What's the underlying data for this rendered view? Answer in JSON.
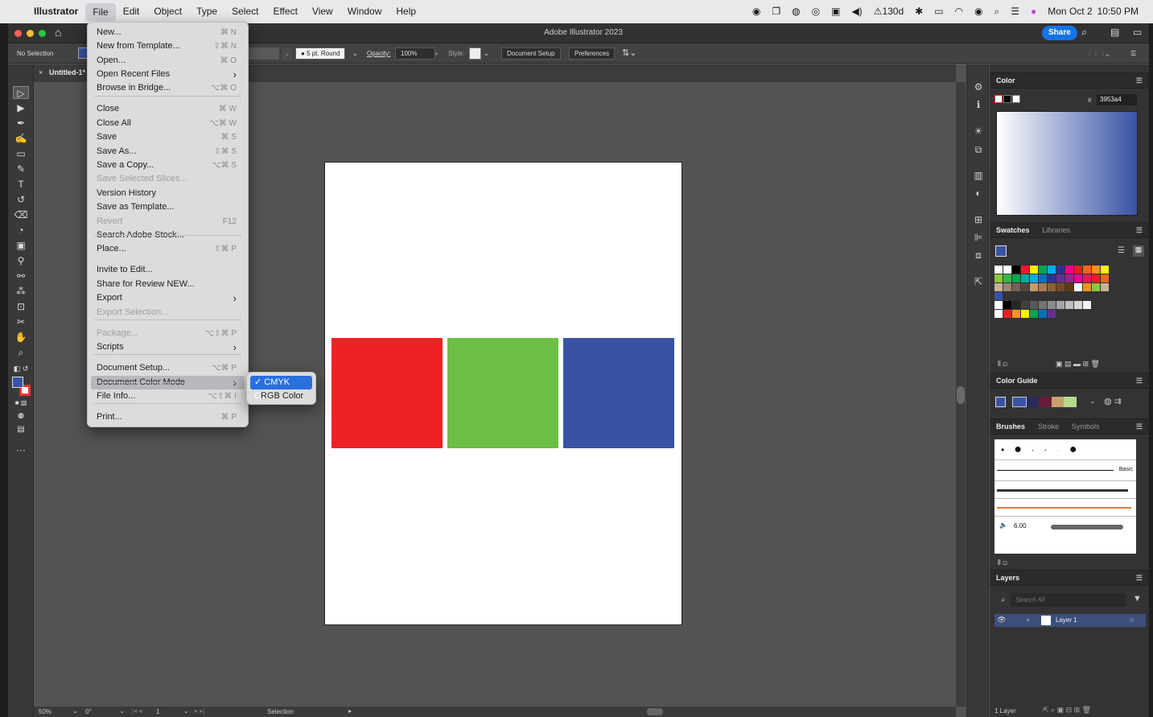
{
  "menubar": {
    "app": "Illustrator",
    "items": [
      "File",
      "Edit",
      "Object",
      "Type",
      "Select",
      "Effect",
      "View",
      "Window",
      "Help"
    ],
    "status": {
      "hdr": "130d",
      "date": "Mon Oct 2",
      "time": "10:50 PM"
    }
  },
  "window": {
    "title": "Adobe Illustrator 2023",
    "share_label": "Share"
  },
  "control": {
    "selection": "No Selection",
    "brush": "5 pt. Round",
    "opacity_label": "Opacity:",
    "opacity": "100%",
    "style_label": "Style:",
    "doc_setup": "Document Setup",
    "preferences": "Preferences"
  },
  "tab": {
    "label": "Untitled-1*"
  },
  "file_menu": [
    {
      "label": "New...",
      "shortcut": "⌘ N",
      "sep_before": false
    },
    {
      "label": "New from Template...",
      "shortcut": "⇧⌘ N"
    },
    {
      "label": "Open...",
      "shortcut": "⌘ O"
    },
    {
      "label": "Open Recent Files",
      "shortcut": "›"
    },
    {
      "label": "Browse in Bridge...",
      "shortcut": "⌥⌘ O"
    },
    {
      "label": "Close",
      "shortcut": "⌘ W",
      "sep_before": true
    },
    {
      "label": "Close All",
      "shortcut": "⌥⌘ W"
    },
    {
      "label": "Save",
      "shortcut": "⌘ S"
    },
    {
      "label": "Save As...",
      "shortcut": "⇧⌘ S"
    },
    {
      "label": "Save a Copy...",
      "shortcut": "⌥⌘ S"
    },
    {
      "label": "Save Selected Slices...",
      "shortcut": "",
      "disabled": true
    },
    {
      "label": "Version History",
      "shortcut": ""
    },
    {
      "label": "Save as Template...",
      "shortcut": ""
    },
    {
      "label": "Revert",
      "shortcut": "F12",
      "disabled": true
    },
    {
      "label": "Search Adobe Stock...",
      "shortcut": ""
    },
    {
      "label": "Place...",
      "shortcut": "⇧⌘ P"
    },
    {
      "label": "Invite to Edit...",
      "shortcut": "",
      "sep_before": true
    },
    {
      "label": "Share for Review NEW...",
      "shortcut": ""
    },
    {
      "label": "Export",
      "shortcut": "›"
    },
    {
      "label": "Export Selection...",
      "shortcut": "",
      "disabled": true
    },
    {
      "label": "Package...",
      "shortcut": "⌥⇧⌘ P",
      "disabled": true,
      "sep_before": true
    },
    {
      "label": "Scripts",
      "shortcut": "›"
    },
    {
      "label": "Document Setup...",
      "shortcut": "⌥⌘ P",
      "sep_before": true
    },
    {
      "label": "Document Color Mode",
      "shortcut": "›",
      "highlight": true
    },
    {
      "label": "File Info...",
      "shortcut": "⌥⇧⌘ I"
    },
    {
      "label": "Print...",
      "shortcut": "⌘ P",
      "sep_before": true
    }
  ],
  "color_mode_menu": [
    {
      "label": "✓ CMYK Color",
      "selected": true
    },
    {
      "label": "RGB Color",
      "selected": false
    }
  ],
  "artboard": {
    "squares": [
      {
        "name": "red-square",
        "color": "#ed2224"
      },
      {
        "name": "green-square",
        "color": "#6dbe45"
      },
      {
        "name": "blue-square",
        "color": "#3953a4"
      }
    ]
  },
  "panels": {
    "color": {
      "title": "Color",
      "hex_label": "#",
      "hex": "3953a4"
    },
    "swatches": {
      "tab1": "Swatches",
      "tab2": "Libraries"
    },
    "color_guide": {
      "title": "Color Guide"
    },
    "brushes": {
      "tab1": "Brushes",
      "tab2": "Stroke",
      "tab3": "Symbols",
      "basic": "Basic",
      "size": "6.00"
    },
    "layers": {
      "title": "Layers",
      "search_placeholder": "Search All",
      "layer_name": "Layer 1",
      "footer": "1 Layer"
    }
  },
  "status": {
    "zoom": "50%",
    "rotation": "0°",
    "artboard": "1",
    "mode": "Selection"
  }
}
